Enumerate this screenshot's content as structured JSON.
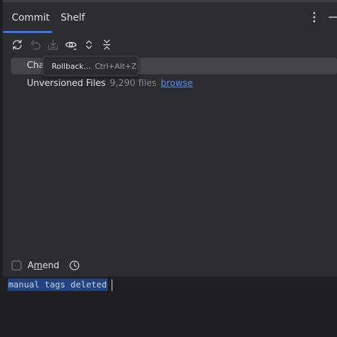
{
  "tabs": [
    {
      "label": "Commit",
      "active": true
    },
    {
      "label": "Shelf",
      "active": false
    }
  ],
  "header": {
    "more_icon": "more-vertical-icon",
    "minimize_icon": "minimize-icon"
  },
  "toolbar": {
    "buttons": [
      {
        "name": "refresh-icon",
        "enabled": true
      },
      {
        "name": "rollback-icon",
        "enabled": false
      },
      {
        "name": "shelve-download-icon",
        "enabled": false
      },
      {
        "name": "eye-icon",
        "enabled": true
      },
      {
        "name": "expand-all-icon",
        "enabled": true
      },
      {
        "name": "collapse-all-icon",
        "enabled": true
      }
    ]
  },
  "tooltip": {
    "label": "Rollback...",
    "shortcut": "Ctrl+Alt+Z"
  },
  "tree": {
    "changes_label": "Cha",
    "unversioned_label": "Unversioned Files",
    "unversioned_count": "9,290 files",
    "browse_link": "browse"
  },
  "amend": {
    "label_before": "A",
    "label_mnemonic": "m",
    "label_after": "end",
    "checked": false,
    "history_icon": "clock-icon"
  },
  "commit_message": {
    "value": "manual tags deleted"
  },
  "colors": {
    "accent": "#3574f0",
    "link": "#548af7",
    "background": "#2b2d30",
    "editor_background": "#1e1f22",
    "selection": "#214283"
  }
}
